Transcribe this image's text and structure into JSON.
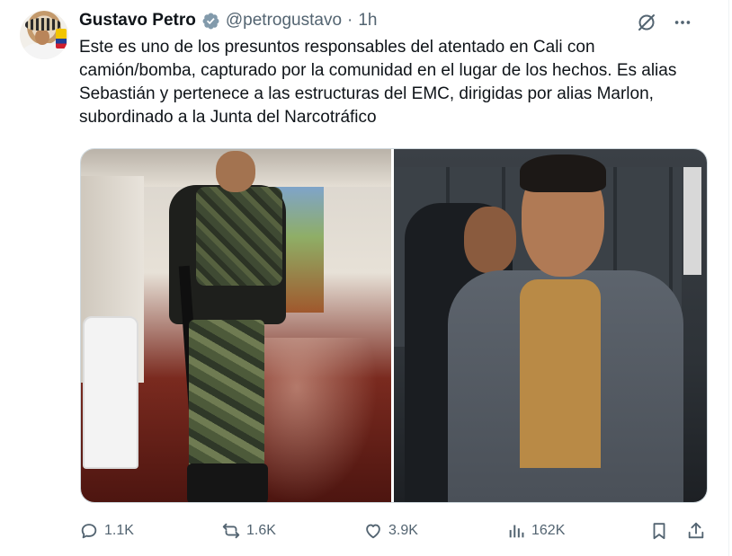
{
  "author": {
    "name": "Gustavo Petro",
    "handle": "@petrogustavo",
    "separator": "·",
    "time": "1h",
    "verified": true
  },
  "tweet": {
    "text": "Este es uno de los presuntos responsables del atentado en Cali con camión/bomba, capturado por la comunidad en el lugar de los hechos. Es alias Sebastián y pertenece a las estructuras del EMC, dirigidas por alias Marlon, subordinado a la Junta del Narcotráfico"
  },
  "media": {
    "count": 2,
    "images": [
      {
        "name": "photo-armed-man-camouflage"
      },
      {
        "name": "photo-detained-suspect"
      }
    ]
  },
  "actions": {
    "replies": "1.1K",
    "retweets": "1.6K",
    "likes": "3.9K",
    "views": "162K"
  },
  "icons": {
    "verified": "verified-badge-icon",
    "grok": "grok-icon",
    "more": "more-icon",
    "reply": "reply-icon",
    "retweet": "retweet-icon",
    "like": "heart-icon",
    "views": "views-icon",
    "bookmark": "bookmark-icon",
    "share": "share-icon"
  },
  "colors": {
    "text": "#0f1419",
    "secondary": "#536471",
    "verified": "#829aab",
    "border": "#cfd9de"
  }
}
